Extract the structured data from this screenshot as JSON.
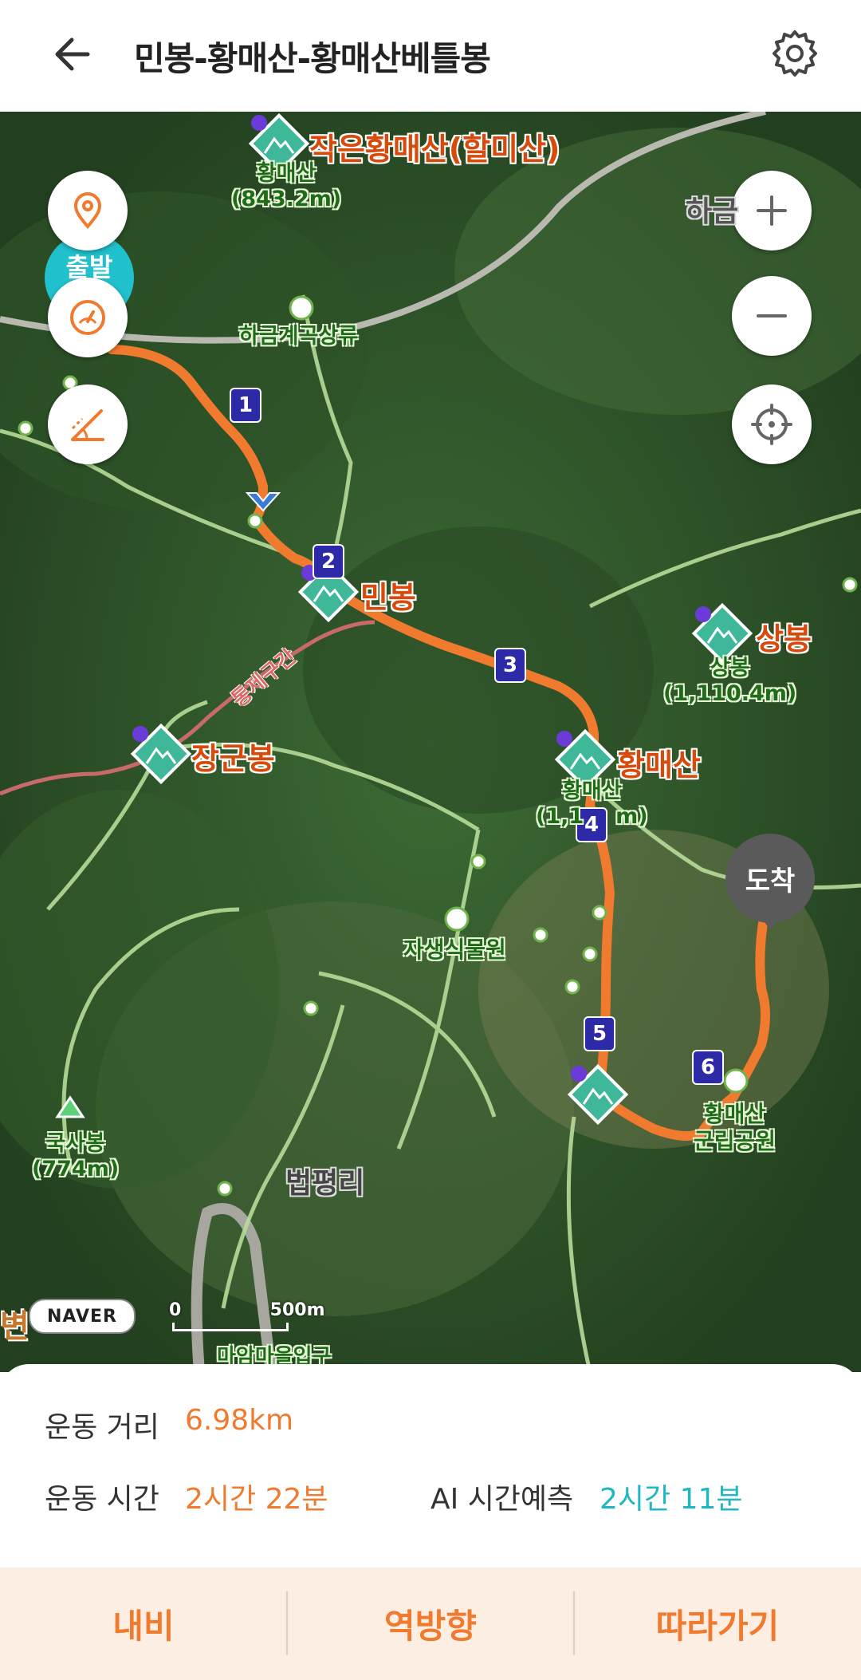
{
  "header": {
    "title": "민봉-황매산-황매산베틀봉"
  },
  "map": {
    "start_label": "출발",
    "end_label": "도착",
    "peaks": {
      "small_hwangmae": "작은황매산(할미산)",
      "hwangmae_sub_name": "황매산",
      "hwangmae_sub_elev": "(843.2m)",
      "minbong": "민봉",
      "sangbong": "상봉",
      "sangbong_sub_name": "상봉",
      "sangbong_sub_elev": "(1,110.4m)",
      "janggunbong": "장군봉",
      "hwangmaesan": "황매산",
      "hwangmaesan_sub_name": "황매산",
      "hwangmaesan_sub_elev": "(1,1",
      "hwangmaesan_sub_elev_tail": "m)",
      "guksabong_name": "국사봉",
      "guksabong_elev": "(774m)"
    },
    "places": {
      "hageum_upper": "하금계곡상류",
      "hageum": "하금",
      "jasaeng": "자생식물원",
      "beopyeong": "법평리",
      "county_park_1": "황매산",
      "county_park_2": "군립공원",
      "restricted": "통제구간",
      "bottom_partial": "마암마을입구",
      "left_partial": "변"
    },
    "waypoints": [
      "1",
      "2",
      "3",
      "4",
      "5",
      "6"
    ],
    "naver_badge": "NAVER",
    "scale_zero": "0",
    "scale_label": "500m",
    "route_color": "#f07a2e"
  },
  "stats": {
    "distance_label": "운동 거리",
    "distance_value": "6.98km",
    "time_label": "운동 시간",
    "time_value": "2시간 22분",
    "ai_label": "AI 시간예측",
    "ai_value": "2시간 11분"
  },
  "actions": {
    "navigate": "내비",
    "reverse": "역방향",
    "follow": "따라가기"
  }
}
